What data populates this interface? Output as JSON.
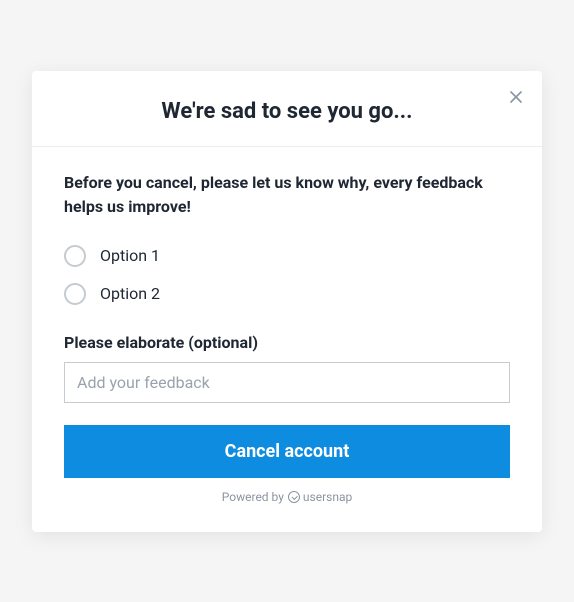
{
  "modal": {
    "title": "We're sad to see you go...",
    "prompt": "Before you cancel, please let us know why, every feedback helps us improve!",
    "options": [
      {
        "label": "Option 1"
      },
      {
        "label": "Option 2"
      }
    ],
    "elaborate_label": "Please elaborate (optional)",
    "feedback_placeholder": "Add your feedback",
    "submit_label": "Cancel account",
    "powered_by_prefix": "Powered by",
    "powered_by_brand": "usersnap"
  }
}
